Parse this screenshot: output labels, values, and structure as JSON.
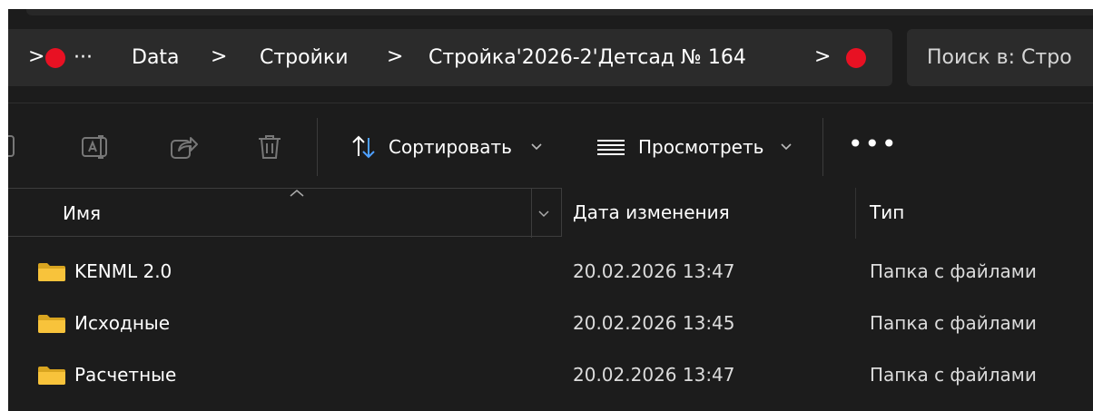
{
  "address_bar": {
    "more_label": "···",
    "breadcrumbs": [
      "Data",
      "Стройки",
      "Стройка'2026-2'Детсад № 164"
    ],
    "separator": ">"
  },
  "search": {
    "placeholder": "Поиск в: Стро"
  },
  "toolbar": {
    "sort_label": "Сортировать",
    "view_label": "Просмотреть",
    "more_label": "•••"
  },
  "columns": {
    "name": "Имя",
    "date": "Дата изменения",
    "type": "Тип"
  },
  "files": [
    {
      "name": "KENML 2.0",
      "date": "20.02.2026 13:47",
      "type": "Папка с файлами"
    },
    {
      "name": "Исходные",
      "date": "20.02.2026 13:45",
      "type": "Папка с файлами"
    },
    {
      "name": "Расчетные",
      "date": "20.02.2026 13:47",
      "type": "Папка с файлами"
    }
  ],
  "colors": {
    "background": "#1c1c1c",
    "bar": "#2b2b2b",
    "status_dot": "#e81123",
    "folder": "#f8c33b"
  }
}
